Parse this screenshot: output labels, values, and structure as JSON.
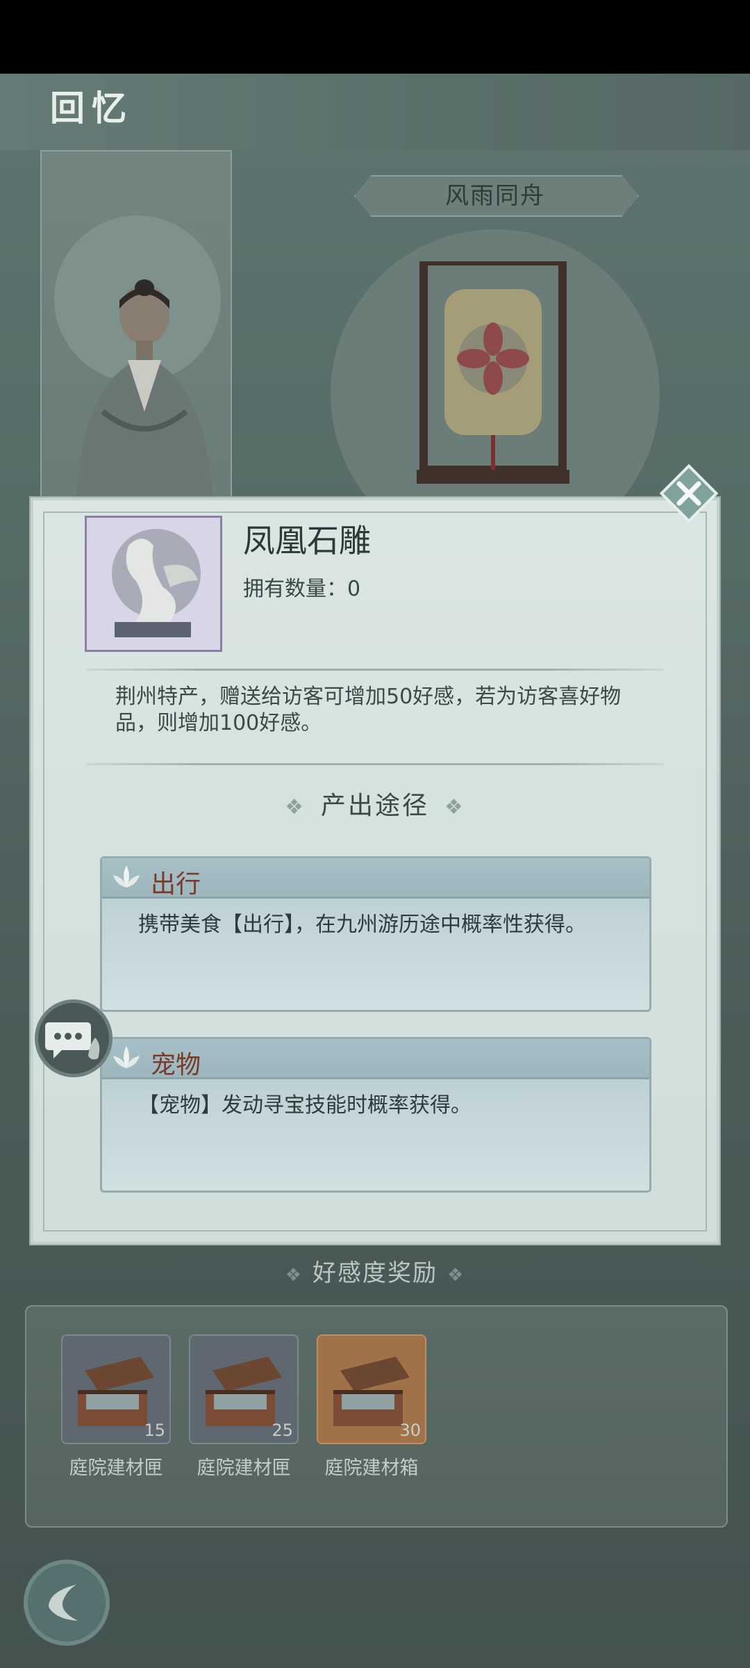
{
  "header": {
    "title": "回忆"
  },
  "scene": {
    "theme_label": "风雨同舟"
  },
  "item": {
    "name": "凤凰石雕",
    "owned_label": "拥有数量：",
    "owned_value": "0",
    "description": "荆州特产，赠送给访客可增加50好感，若为访客喜好物品，则增加100好感。"
  },
  "sources": {
    "title": "产出途径",
    "items": [
      {
        "label": "出行",
        "text": "携带美食【出行】，在九州游历途中概率性获得。"
      },
      {
        "label": "宠物",
        "text": "【宠物】发动寻宝技能时概率获得。"
      }
    ]
  },
  "favor": {
    "title": "好感度奖励",
    "rewards": [
      {
        "name": "庭院建材匣",
        "count": "15",
        "tier": "normal"
      },
      {
        "name": "庭院建材匣",
        "count": "25",
        "tier": "normal"
      },
      {
        "name": "庭院建材箱",
        "count": "30",
        "tier": "gold"
      }
    ]
  },
  "colors": {
    "dialog_bg": "#dbe6e4",
    "source_label": "#7a3a2a",
    "gold_tier": "#a0724a"
  },
  "icons": [
    "close-icon",
    "lotus-icon",
    "chat-icon",
    "back-icon",
    "chest-icon",
    "phoenix-sculpture-icon"
  ]
}
